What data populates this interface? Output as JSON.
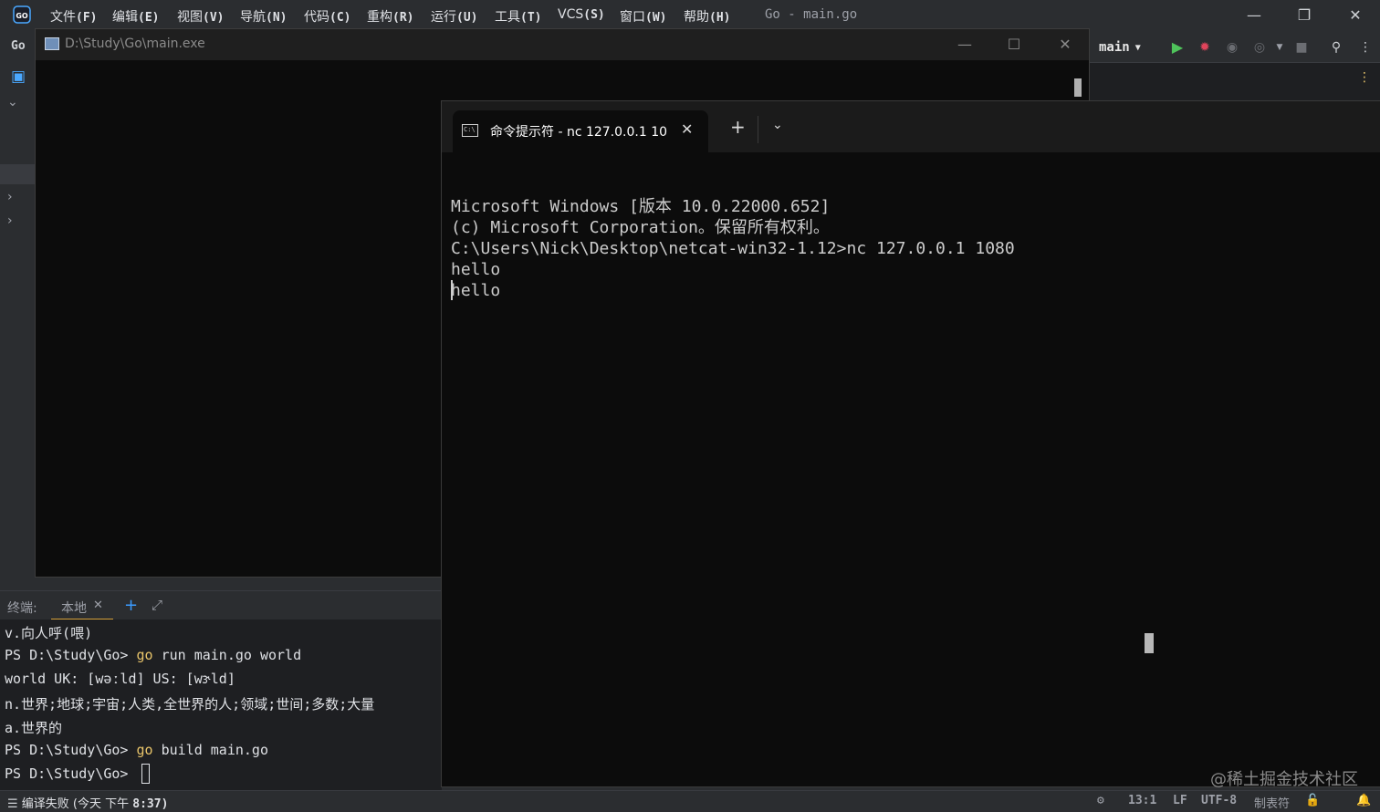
{
  "ide": {
    "menu": [
      {
        "label": "文件",
        "key": "(F)"
      },
      {
        "label": "编辑",
        "key": "(E)"
      },
      {
        "label": "视图",
        "key": "(V)"
      },
      {
        "label": "导航",
        "key": "(N)"
      },
      {
        "label": "代码",
        "key": "(C)"
      },
      {
        "label": "重构",
        "key": "(R)"
      },
      {
        "label": "运行",
        "key": "(U)"
      },
      {
        "label": "工具",
        "key": "(T)"
      },
      {
        "label": "VCS",
        "key": "(S)"
      },
      {
        "label": "窗口",
        "key": "(W)"
      },
      {
        "label": "帮助",
        "key": "(H)"
      }
    ],
    "title": "Go - main.go",
    "project_label": "Go",
    "run_config": "main",
    "accent_color": "#3b9bff"
  },
  "exe_window": {
    "title": "D:\\Study\\Go\\main.exe"
  },
  "cmd_window": {
    "tab_title": "命令提示符 - nc  127.0.0.1 1080",
    "lines": [
      "Microsoft Windows [版本 10.0.22000.652]",
      "(c) Microsoft Corporation。保留所有权利。",
      "",
      "C:\\Users\\Nick\\Desktop\\netcat-win32-1.12>nc 127.0.0.1 1080",
      "hello",
      "hello"
    ]
  },
  "terminal": {
    "label": "终端:",
    "tab": "本地",
    "lines": [
      {
        "text": "v.向人呼(喂)"
      },
      {
        "prompt": "PS D:\\Study\\Go> ",
        "cmd": "go",
        "args": " run main.go world"
      },
      {
        "text": "world UK: [wəːld] US: [wɝld]"
      },
      {
        "text": "n.世界;地球;宇宙;人类,全世界的人;领域;世间;多数;大量"
      },
      {
        "text": "a.世界的"
      },
      {
        "prompt": "PS D:\\Study\\Go> ",
        "cmd": "go",
        "args": " build main.go"
      },
      {
        "prompt": "PS D:\\Study\\Go> "
      }
    ],
    "keyword_color": "#e8c46a"
  },
  "statusbar": {
    "left_text": "编译失败 (今天 下午 ",
    "left_time": "8:37)",
    "position": "13:1",
    "line_sep": "LF",
    "encoding": "UTF-8",
    "indent": "制表符"
  },
  "watermark": "@稀土掘金技术社区"
}
